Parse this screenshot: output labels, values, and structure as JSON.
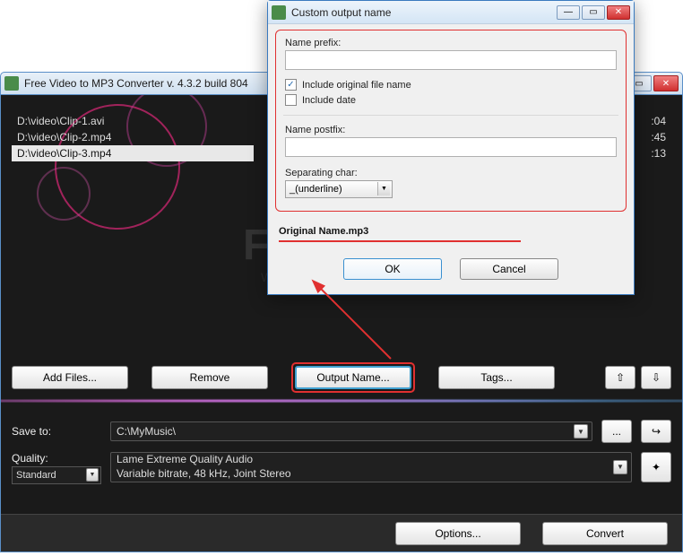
{
  "main": {
    "title": "Free Video to MP3 Converter  v. 4.3.2 build 804",
    "bg_text": "FRE",
    "bg_sub": "WWW.D",
    "files": [
      {
        "path": "D:\\video\\Clip-1.avi"
      },
      {
        "path": "D:\\video\\Clip-2.mp4"
      },
      {
        "path": "D:\\video\\Clip-3.mp4"
      }
    ],
    "selected_index": 2,
    "times": [
      ":04",
      ":45",
      ":13"
    ],
    "toolbar": {
      "add_files": "Add Files...",
      "remove": "Remove",
      "output_name": "Output Name...",
      "tags": "Tags...",
      "up_glyph": "⇧",
      "down_glyph": "⇩"
    },
    "save_to_label": "Save to:",
    "save_to_value": "C:\\MyMusic\\",
    "browse_glyph": "...",
    "open_glyph": "↪",
    "quality_label": "Quality:",
    "quality_value": "Standard",
    "quality_preset_line1": "Lame Extreme Quality Audio",
    "quality_preset_line2": "Variable bitrate, 48 kHz, Joint Stereo",
    "wand_glyph": "✦",
    "options": "Options...",
    "convert": "Convert"
  },
  "dialog": {
    "title": "Custom output name",
    "prefix_label": "Name prefix:",
    "prefix_value": "",
    "include_original_label": "Include original file name",
    "include_original_checked": true,
    "include_date_label": "Include date",
    "include_date_checked": false,
    "postfix_label": "Name postfix:",
    "postfix_value": "",
    "sep_label": "Separating char:",
    "sep_value": "_(underline)",
    "preview": "Original Name.mp3",
    "ok": "OK",
    "cancel": "Cancel",
    "min_glyph": "—",
    "max_glyph": "▭",
    "close_glyph": "✕",
    "check_glyph": "✓"
  }
}
